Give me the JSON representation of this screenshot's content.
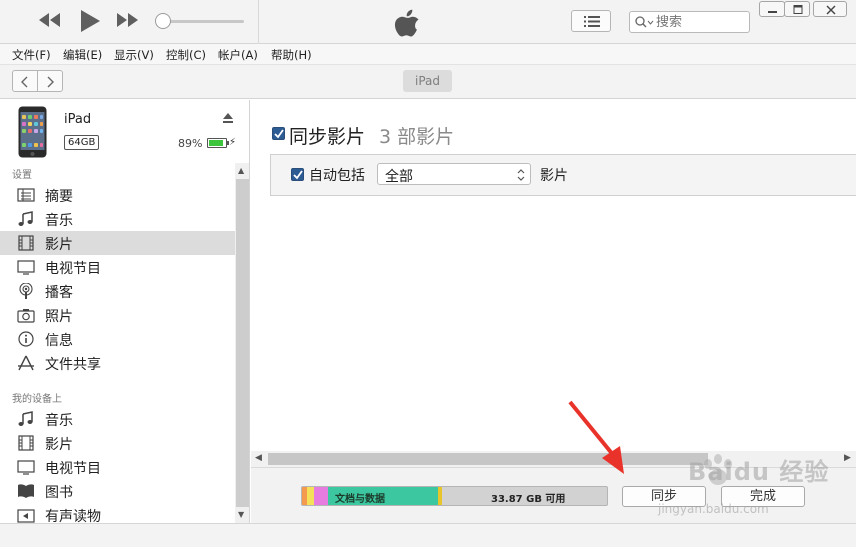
{
  "toolbar": {
    "search_placeholder": "搜索"
  },
  "menu": [
    {
      "label": "文件(F)"
    },
    {
      "label": "编辑(E)"
    },
    {
      "label": "显示(V)"
    },
    {
      "label": "控制(C)"
    },
    {
      "label": "帐户(A)"
    },
    {
      "label": "帮助(H)"
    }
  ],
  "navbar": {
    "device_pill": "iPad"
  },
  "device": {
    "name": "iPad",
    "capacity": "64GB",
    "battery_percent": "89%",
    "battery_level": 0.89
  },
  "sidebar": {
    "settings_header": "设置",
    "settings_items": [
      {
        "label": "摘要",
        "icon": "summary-icon"
      },
      {
        "label": "音乐",
        "icon": "music-icon"
      },
      {
        "label": "影片",
        "icon": "film-icon",
        "active": true
      },
      {
        "label": "电视节目",
        "icon": "tv-icon"
      },
      {
        "label": "播客",
        "icon": "podcast-icon"
      },
      {
        "label": "照片",
        "icon": "camera-icon"
      },
      {
        "label": "信息",
        "icon": "info-icon"
      },
      {
        "label": "文件共享",
        "icon": "appstore-icon"
      }
    ],
    "mydevice_header": "我的设备上",
    "mydevice_items": [
      {
        "label": "音乐",
        "icon": "music-icon"
      },
      {
        "label": "影片",
        "icon": "film-icon"
      },
      {
        "label": "电视节目",
        "icon": "tv-icon"
      },
      {
        "label": "图书",
        "icon": "book-icon"
      },
      {
        "label": "有声读物",
        "icon": "audiobook-icon"
      }
    ]
  },
  "main": {
    "sync_label": "同步影片",
    "sync_count": "3 部影片",
    "auto_include_label": "自动包括",
    "auto_include_value": "全部",
    "movies_label": "影片"
  },
  "storage": {
    "docs_label": "文档与数据",
    "free_label": "33.87 GB 可用",
    "colors": {
      "orange": "#f39a4e",
      "yellow": "#f5e05a",
      "pink": "#e67be0",
      "teal": "#3cc7a0",
      "gold": "#e8c52a",
      "free": "#d2d2d2"
    }
  },
  "buttons": {
    "sync": "同步",
    "done": "完成"
  },
  "watermark": {
    "text": "Baidu 经验",
    "url": "jingyan.baidu.com"
  },
  "colors": {
    "accent_red": "#e8322a",
    "checkbox_blue": "#2d5b93",
    "battery_green": "#3cc43c"
  }
}
